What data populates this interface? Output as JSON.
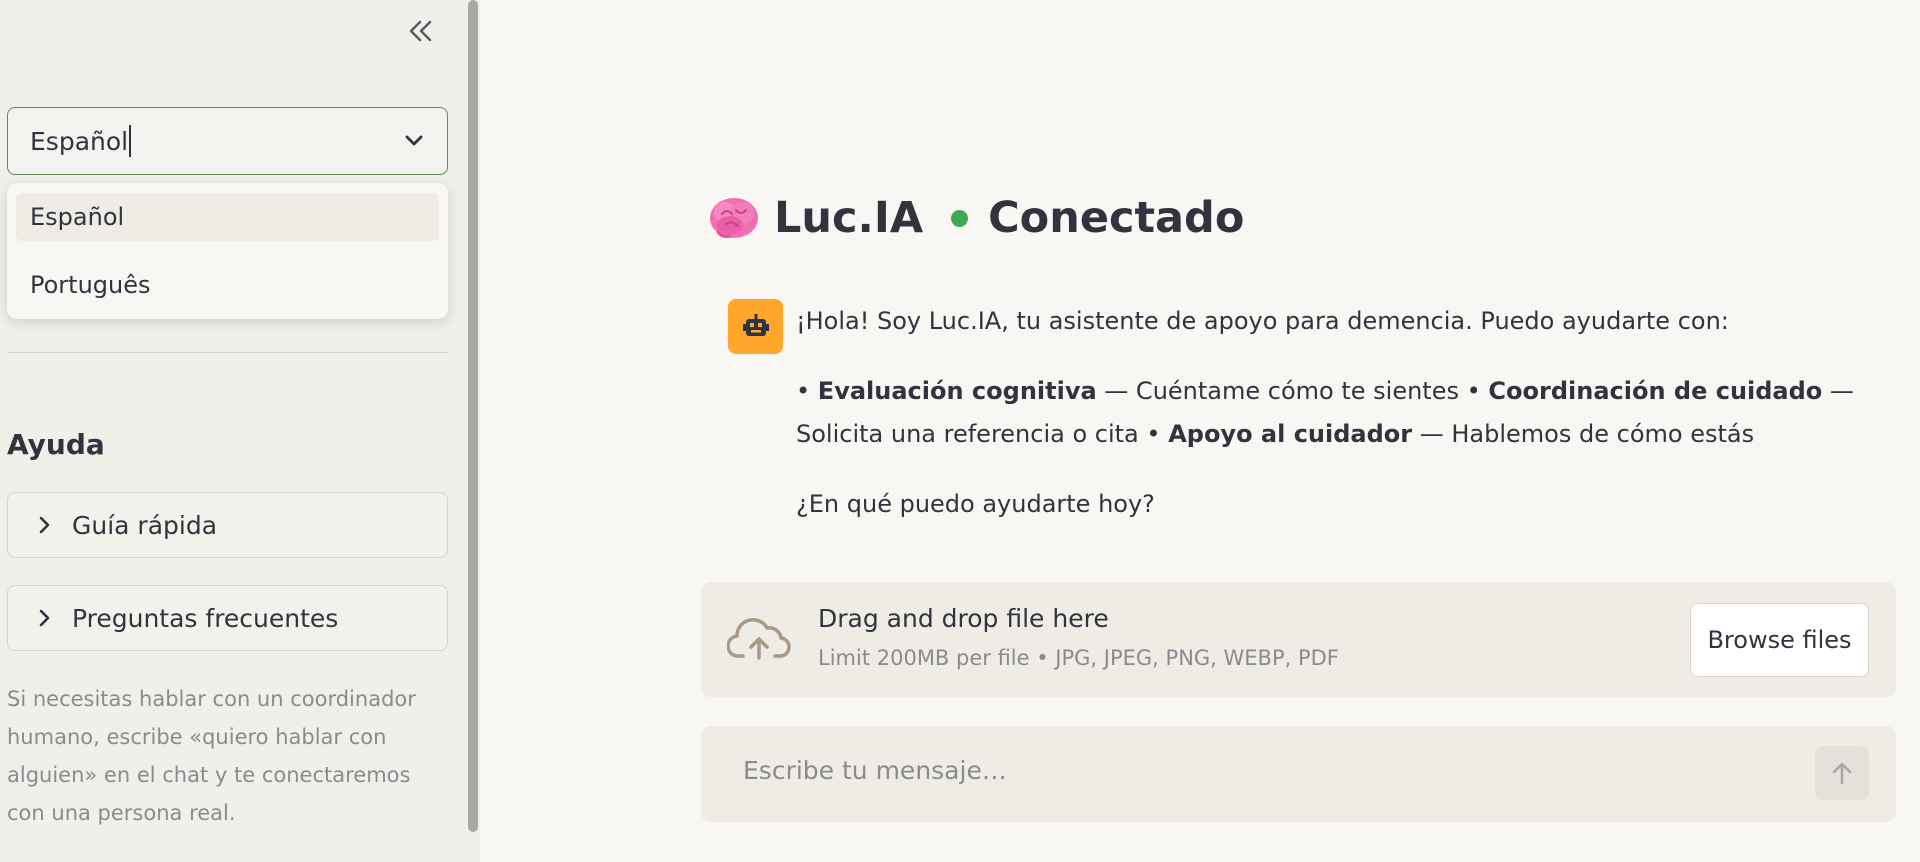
{
  "sidebar": {
    "collapse_icon": "double-chevron-left-icon",
    "language_select": {
      "value": "Español",
      "options": [
        "Español",
        "Português"
      ]
    },
    "help": {
      "title": "Ayuda",
      "expanders": [
        "Guía rápida",
        "Preguntas frecuentes"
      ],
      "note": "Si necesitas hablar con un coordinador humano, escribe «quiero hablar con alguien» en el chat y te conectaremos con una persona real."
    }
  },
  "header": {
    "app_name": "Luc.IA",
    "status": "Conectado",
    "status_color": "#3fa855"
  },
  "message": {
    "avatar_color": "#ffa62b",
    "intro": "¡Hola! Soy Luc.IA, tu asistente de apoyo para demencia. Puedo ayudarte con:",
    "items": [
      {
        "title": "Evaluación cognitiva",
        "desc": " — Cuéntame cómo te sientes "
      },
      {
        "title": "Coordinación de cuidado",
        "desc": " — Solicita una referencia o cita "
      },
      {
        "title": "Apoyo al cuidador",
        "desc": " — Hablemos de cómo estás"
      }
    ],
    "question": "¿En qué puedo ayudarte hoy?"
  },
  "uploader": {
    "drag_text": "Drag and drop file here",
    "limit_text": "Limit 200MB per file • JPG, JPEG, PNG, WEBP, PDF",
    "browse_label": "Browse files"
  },
  "chat_input": {
    "placeholder": "Escribe tu mensaje…"
  }
}
